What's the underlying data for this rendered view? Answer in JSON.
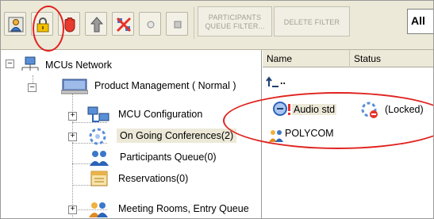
{
  "toolbar": {
    "participants_queue_filter_label": "PARTICIPANTS QUEUE FILTER...",
    "delete_filter_label": "DELETE FILTER",
    "all_label": "All",
    "icons": [
      "participant-icon",
      "lock-icon",
      "stop-hand-icon",
      "upload-icon",
      "disconnect-icon",
      "circle-icon",
      "square-icon"
    ]
  },
  "tree": {
    "root_label": "MCUs Network",
    "mcu_label": "Product Management   ( Normal )",
    "items": [
      {
        "label": "MCU Configuration",
        "icon": "mcu-config-icon"
      },
      {
        "label": "On Going Conferences(2)",
        "icon": "conference-icon"
      },
      {
        "label": "Participants Queue(0)",
        "icon": "participants-icon"
      },
      {
        "label": "Reservations(0)",
        "icon": "reservations-icon"
      },
      {
        "label": "Meeting Rooms, Entry Queue",
        "icon": "meeting-rooms-icon"
      }
    ]
  },
  "list": {
    "columns": [
      "Name",
      "Status"
    ],
    "up_label": "..",
    "rows": [
      {
        "name": "Audio  std",
        "status": "(Locked)"
      },
      {
        "name": "POLYCOM",
        "status": ""
      }
    ]
  },
  "colors": {
    "toolbar_bg": "#ece9d8",
    "annotation": "#e0221e"
  }
}
